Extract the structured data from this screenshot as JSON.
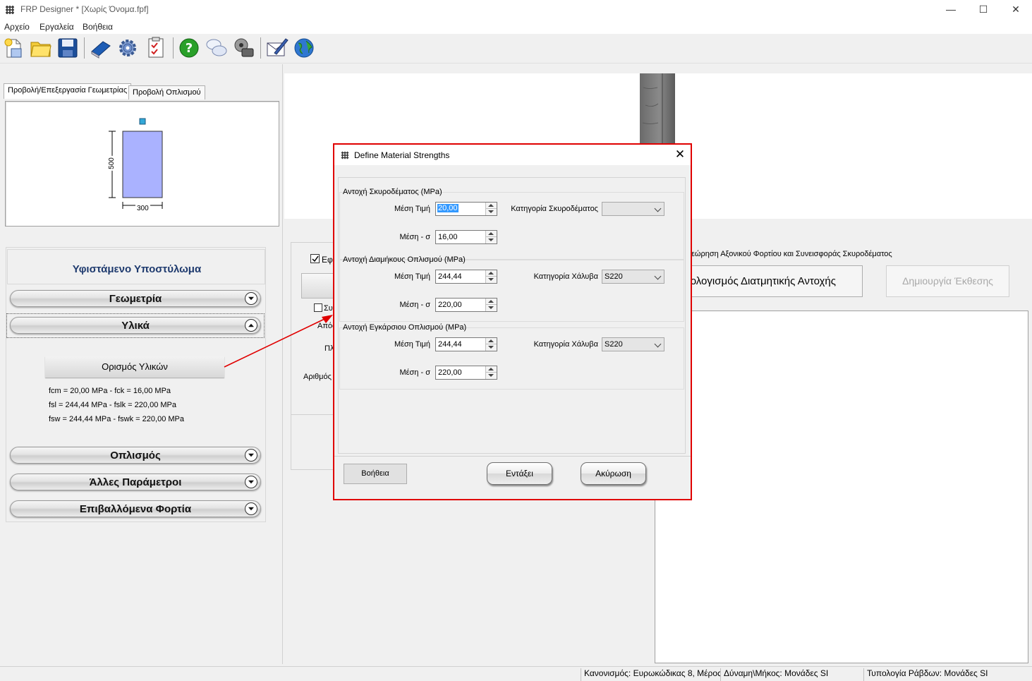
{
  "window": {
    "title": "FRP Designer * [Χωρίς Όνομα.fpf]",
    "controls": {
      "minimize": "—",
      "maximize": "☐",
      "close": "✕"
    }
  },
  "menu": {
    "file": "Αρχείο",
    "tools": "Εργαλεία",
    "help": "Βοήθεια"
  },
  "toolbar": [
    "new-file-icon",
    "open-folder-icon",
    "save-disk-icon",
    "manual-book-icon",
    "settings-gear-icon",
    "checklist-icon",
    "help-question-icon",
    "chat-bubbles-icon",
    "film-reel-icon",
    "email-pen-icon",
    "globe-icon"
  ],
  "left": {
    "tabs": {
      "geometry": "Προβολή/Επεξεργασία Γεωμετρίας",
      "reinforcement": "Προβολή Οπλισμού"
    },
    "section": {
      "height": "500",
      "width": "300"
    },
    "panel_title": "Υφιστάμενο Υποστύλωμα",
    "accordion": {
      "geometry": "Γεωμετρία",
      "materials": "Υλικά",
      "reinforcement": "Οπλισμός",
      "other": "Άλλες Παράμετροι",
      "loads": "Επιβαλλόμενα Φορτία"
    },
    "materials_button": "Ορισμός Υλικών",
    "materials_summary": [
      "fcm = 20,00 MPa   -   fck = 16,00 MPa",
      "fsl = 244,44 MPa   -   fslk = 220,00 MPa",
      "fsw = 244,44 MPa   -   fswk = 220,00 MPa"
    ]
  },
  "background": {
    "check1_label": "Εφ",
    "check2_label": "Συ",
    "label_a": "Απόσ",
    "label_b": "Πλ",
    "label_c": "Αριθμός",
    "axial_note": "εώρηση Αξονικού Φορτίου και Συνεισφοράς Σκυροδέματος",
    "calc_button": "τολογισμός Διατμητικής Αντοχής",
    "report_button": "Δημιουργία Έκθεσης"
  },
  "status": {
    "code": "Κανονισμός: Ευρωκώδικας 8, Μέρος",
    "units": "Δύναμη\\Μήκος: Μονάδες SI",
    "bars": "Τυπολογία Ράβδων: Μονάδες SI"
  },
  "dialog": {
    "title": "Define Material Strengths",
    "close": "✕",
    "concrete": {
      "title": "Αντοχή Σκυροδέματος (MPa)",
      "mean_label": "Μέση Τιμή",
      "mean_value": "20,00",
      "mean_sigma_label": "Μέση - σ",
      "mean_sigma_value": "16,00",
      "class_label": "Κατηγορία Σκυροδέματος",
      "class_value": ""
    },
    "longitudinal": {
      "title": "Αντοχή Διαμήκους Οπλισμού (MPa)",
      "mean_label": "Μέση Τιμή",
      "mean_value": "244,44",
      "mean_sigma_label": "Μέση - σ",
      "mean_sigma_value": "220,00",
      "class_label": "Κατηγορία Χάλυβα",
      "class_value": "S220"
    },
    "transverse": {
      "title": "Αντοχή Εγκάρσιου Οπλισμού (MPa)",
      "mean_label": "Μέση Τιμή",
      "mean_value": "244,44",
      "mean_sigma_label": "Μέση - σ",
      "mean_sigma_value": "220,00",
      "class_label": "Κατηγορία Χάλυβα",
      "class_value": "S220"
    },
    "buttons": {
      "help": "Βοήθεια",
      "ok": "Εντάξει",
      "cancel": "Ακύρωση"
    }
  },
  "colors": {
    "annotation_red": "#e00000",
    "section_fill": "#aab2ff",
    "title_blue": "#1e3a6e"
  }
}
